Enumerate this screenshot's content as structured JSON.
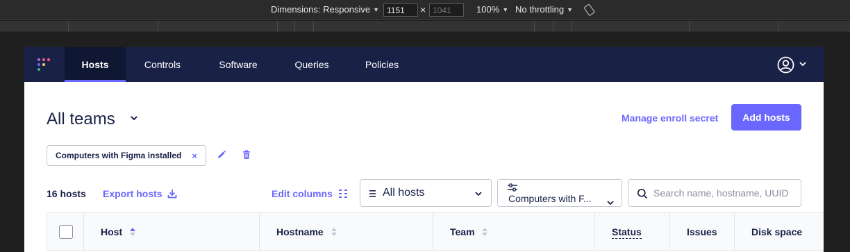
{
  "devtools": {
    "dimensions_label": "Dimensions: Responsive",
    "width_value": "1151",
    "height_placeholder": "1041",
    "times": "×",
    "zoom": "100%",
    "throttling": "No throttling"
  },
  "nav": {
    "tabs": [
      {
        "label": "Hosts",
        "active": true
      },
      {
        "label": "Controls"
      },
      {
        "label": "Software"
      },
      {
        "label": "Queries"
      },
      {
        "label": "Policies"
      }
    ]
  },
  "header": {
    "title": "All teams",
    "manage_enroll_secret": "Manage enroll secret",
    "add_hosts": "Add hosts"
  },
  "filter": {
    "label": "Computers with Figma installed",
    "remove": "×"
  },
  "toolbar": {
    "host_count": "16 hosts",
    "export_hosts": "Export hosts",
    "edit_columns": "Edit columns",
    "status_select": "All hosts",
    "label_filter": "Computers with F...",
    "search_placeholder": "Search name, hostname, UUID"
  },
  "table": {
    "columns": [
      "Host",
      "Hostname",
      "Team",
      "Status",
      "Issues",
      "Disk space"
    ]
  },
  "colors": {
    "nav_bg": "#192147",
    "accent": "#6a67fe",
    "text": "#192147"
  }
}
